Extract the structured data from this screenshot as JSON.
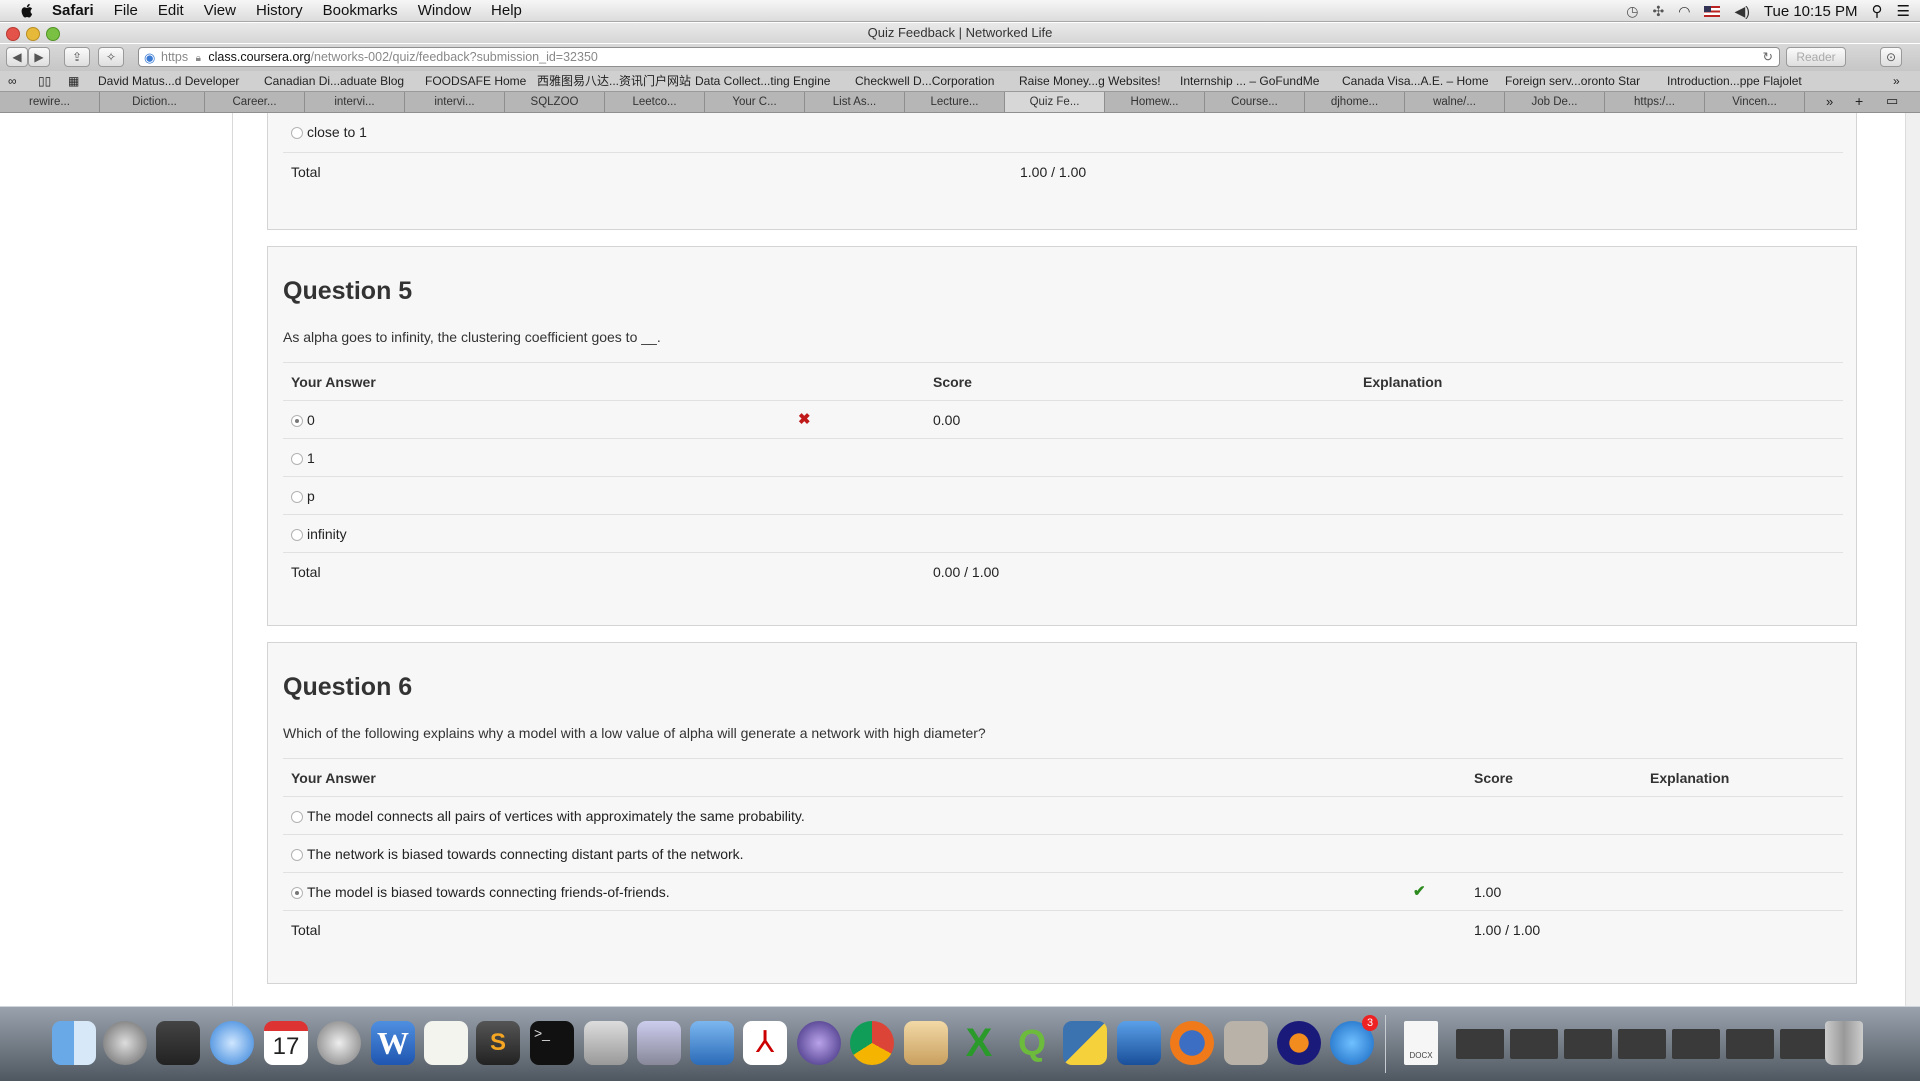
{
  "menubar": {
    "app": "Safari",
    "items": [
      "File",
      "Edit",
      "View",
      "History",
      "Bookmarks",
      "Window",
      "Help"
    ],
    "clock": "Tue 10:15 PM"
  },
  "window": {
    "title": "Quiz Feedback | Networked Life"
  },
  "toolbar": {
    "url_scheme": "https",
    "url_host": "class.coursera.org",
    "url_path": "/networks-002/quiz/feedback?submission_id=32350",
    "reader_label": "Reader"
  },
  "bookmarks": [
    "David Matus...d Developer",
    "Canadian Di...aduate Blog",
    "FOODSAFE Home",
    "西雅图易八达...资讯门户网站",
    "Data Collect...ting Engine",
    "Checkwell D...Corporation",
    "Raise Money...g Websites!",
    "Internship ... – GoFundMe",
    "Canada Visa...A.E. – Home",
    "Foreign serv...oronto Star",
    "Introduction...ppe Flajolet"
  ],
  "tabs": [
    "rewire...",
    "Diction...",
    "Career...",
    "intervi...",
    "intervi...",
    "SQLZOO",
    "Leetco...",
    "Your C...",
    "List As...",
    "Lecture...",
    "Quiz Fe...",
    "Homew...",
    "Course...",
    "djhome...",
    "walne/...",
    "Job De...",
    "https:/...",
    "Vincen..."
  ],
  "q4_tail": {
    "option": "close to 1",
    "total_label": "Total",
    "total_value": "1.00 / 1.00"
  },
  "q5": {
    "title": "Question 5",
    "prompt": "As alpha goes to infinity, the clustering coefficient goes to __.",
    "headers": {
      "answer": "Your Answer",
      "score": "Score",
      "explanation": "Explanation"
    },
    "options": [
      "0",
      "1",
      "p",
      "infinity"
    ],
    "selected_score": "0.00",
    "total_label": "Total",
    "total_value": "0.00 / 1.00"
  },
  "q6": {
    "title": "Question 6",
    "prompt": "Which of the following explains why a model with a low value of alpha will generate a network with high diameter?",
    "headers": {
      "answer": "Your Answer",
      "score": "Score",
      "explanation": "Explanation"
    },
    "options": [
      "The model connects all pairs of vertices with approximately the same probability.",
      "The network is biased towards connecting distant parts of the network.",
      "The model is biased towards connecting friends-of-friends."
    ],
    "selected_score": "1.00",
    "total_label": "Total",
    "total_value": "1.00 / 1.00"
  },
  "dock": {
    "calendar_day": "17",
    "appstore_badge": "3",
    "docx_label": "DOCX"
  }
}
